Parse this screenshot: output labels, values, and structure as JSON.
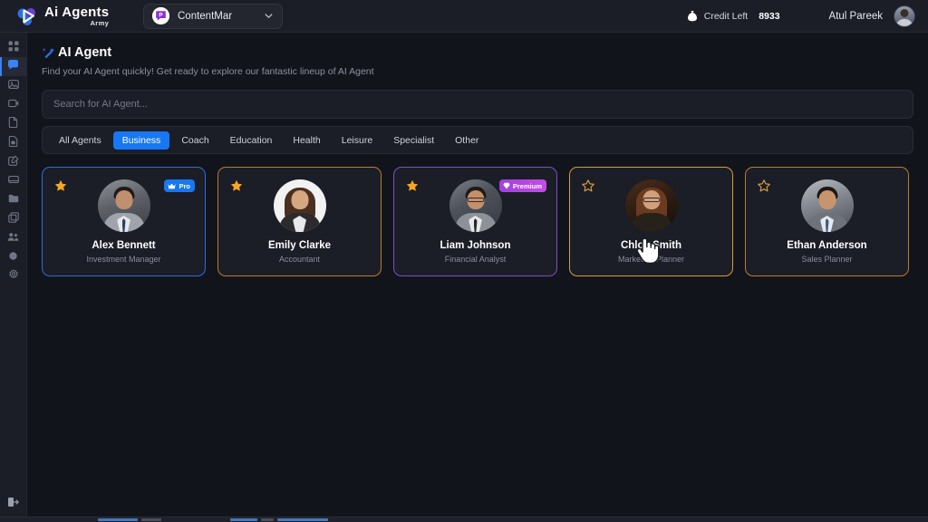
{
  "topbar": {
    "brand_name": "Ai Agents",
    "brand_sub": "Army",
    "logo_icon": "triangle-play-logo",
    "workspace": {
      "icon": "purple-chat-bubble-icon",
      "label": "ContentMar",
      "chevron_icon": "chevron-down-icon"
    },
    "credit": {
      "icon": "money-bag-icon",
      "label": "Credit Left",
      "value": "8933"
    },
    "user": {
      "name": "Atul Pareek",
      "avatar_icon": "user-avatar"
    }
  },
  "sidebar": {
    "items": [
      {
        "icon": "grid-dashboard-icon",
        "active": false
      },
      {
        "icon": "chat-bubble-icon",
        "active": true
      },
      {
        "icon": "image-icon",
        "active": false
      },
      {
        "icon": "video-icon",
        "active": false
      },
      {
        "icon": "document-icon",
        "active": false
      },
      {
        "icon": "file-code-icon",
        "active": false
      },
      {
        "icon": "edit-square-icon",
        "active": false
      },
      {
        "icon": "card-icon",
        "active": false
      },
      {
        "icon": "folder-icon",
        "active": false
      },
      {
        "icon": "copy-icon",
        "active": false
      },
      {
        "icon": "users-icon",
        "active": false
      },
      {
        "icon": "circle-icon",
        "active": false
      },
      {
        "icon": "gear-icon",
        "active": false
      }
    ],
    "bottom_item": {
      "icon": "logout-icon"
    }
  },
  "page": {
    "title_icon": "magic-wand-icon",
    "title": "AI Agent",
    "subtitle": "Find your AI Agent quickly! Get ready to explore our fantastic lineup of AI Agent"
  },
  "search": {
    "placeholder": "Search for AI Agent...",
    "value": ""
  },
  "tabs": [
    {
      "label": "All Agents",
      "active": false
    },
    {
      "label": "Business",
      "active": true
    },
    {
      "label": "Coach",
      "active": false
    },
    {
      "label": "Education",
      "active": false
    },
    {
      "label": "Health",
      "active": false
    },
    {
      "label": "Leisure",
      "active": false
    },
    {
      "label": "Specialist",
      "active": false
    },
    {
      "label": "Other",
      "active": false
    }
  ],
  "agents": [
    {
      "name": "Alex Bennett",
      "role": "Investment Manager",
      "starred": true,
      "badge": {
        "label": "Pro",
        "icon": "crown-icon",
        "type": "pro"
      },
      "accent": "blue"
    },
    {
      "name": "Emily Clarke",
      "role": "Accountant",
      "starred": true,
      "badge": null,
      "accent": "orange"
    },
    {
      "name": "Liam Johnson",
      "role": "Financial Analyst",
      "starred": true,
      "badge": {
        "label": "Premium",
        "icon": "gem-icon",
        "type": "premium"
      },
      "accent": "purple"
    },
    {
      "name": "Chloe Smith",
      "role": "Marketing Planner",
      "starred": false,
      "badge": null,
      "accent": "orange-hover"
    },
    {
      "name": "Ethan Anderson",
      "role": "Sales Planner",
      "starred": false,
      "badge": null,
      "accent": "orange"
    }
  ],
  "colors": {
    "accent_blue": "#1877f2",
    "accent_purple": "#a23fe0",
    "star_gold": "#f5a623",
    "background": "#12141c",
    "panel": "#1b1d27"
  },
  "cursor": {
    "icon": "pointing-hand-cursor"
  }
}
